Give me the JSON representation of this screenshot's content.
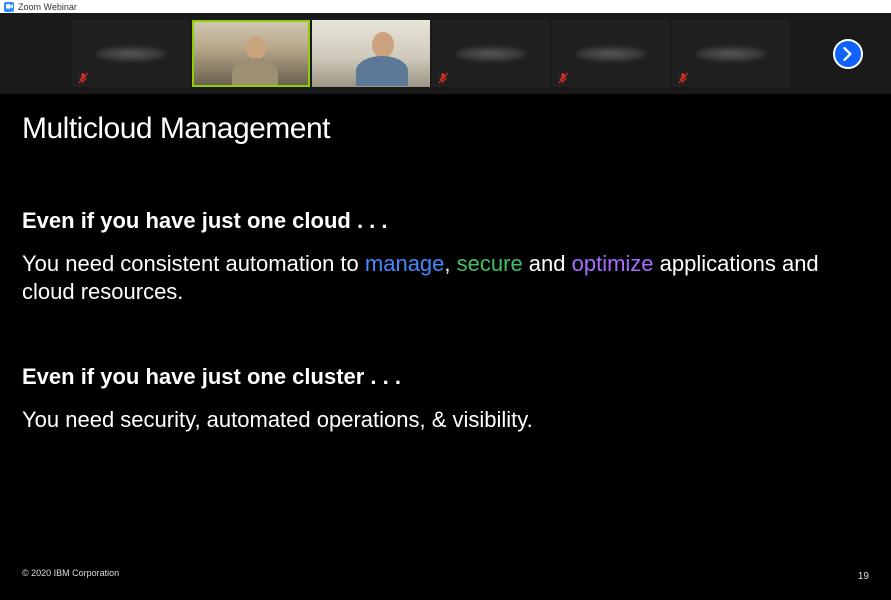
{
  "window": {
    "title": "Zoom Webinar"
  },
  "participants": [
    {
      "muted": true,
      "hidden": true,
      "active": false
    },
    {
      "muted": false,
      "hidden": false,
      "active": true
    },
    {
      "muted": false,
      "hidden": false,
      "active": false
    },
    {
      "muted": true,
      "hidden": true,
      "active": false
    },
    {
      "muted": true,
      "hidden": true,
      "active": false
    },
    {
      "muted": true,
      "hidden": true,
      "active": false
    }
  ],
  "slide": {
    "title": "Multicloud Management",
    "sections": {
      "cloud": {
        "heading": "Even if you have just one cloud . . .",
        "body_pre": "You need consistent automation to ",
        "word_manage": "manage",
        "sep1": ", ",
        "word_secure": "secure",
        "sep2": " and ",
        "word_optimize": "optimize",
        "body_post": " applications and cloud resources."
      },
      "cluster": {
        "heading": "Even if you have just one cluster . . .",
        "body": "You need security, automated operations, & visibility."
      }
    },
    "copyright": "© 2020 IBM Corporation",
    "page_number": "19"
  }
}
